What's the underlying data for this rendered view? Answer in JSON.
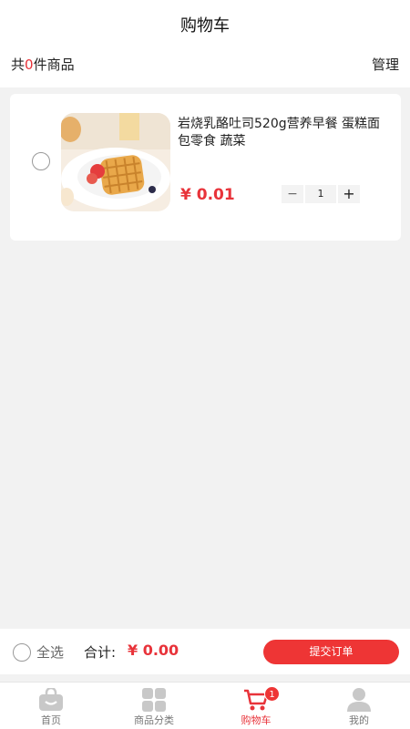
{
  "header": {
    "title": "购物车",
    "summary_prefix": "共",
    "summary_count": "0",
    "summary_suffix": "件商品",
    "manage_label": "管理"
  },
  "cart": {
    "items": [
      {
        "name": "岩烧乳酪吐司520g营养早餐 蛋糕面包零食 蔬菜",
        "price": "¥ 0.01",
        "quantity": "1",
        "minus": "−",
        "plus": "+",
        "image": "waffle-product-photo"
      }
    ]
  },
  "checkout": {
    "select_all_label": "全选",
    "total_label": "合计:",
    "total_value": "¥ 0.00",
    "submit_label": "提交订单"
  },
  "tabbar": {
    "tabs": [
      {
        "label": "首页",
        "icon": "home-bag-icon",
        "active": false
      },
      {
        "label": "商品分类",
        "icon": "category-grid-icon",
        "active": false
      },
      {
        "label": "购物车",
        "icon": "cart-icon",
        "active": true
      },
      {
        "label": "我的",
        "icon": "user-icon",
        "active": false
      }
    ],
    "cart_badge": "1"
  },
  "colors": {
    "accent": "#e8333a",
    "button": "#ee3535",
    "background": "#f2f2f2",
    "icon_inactive": "#c8c8c8"
  }
}
